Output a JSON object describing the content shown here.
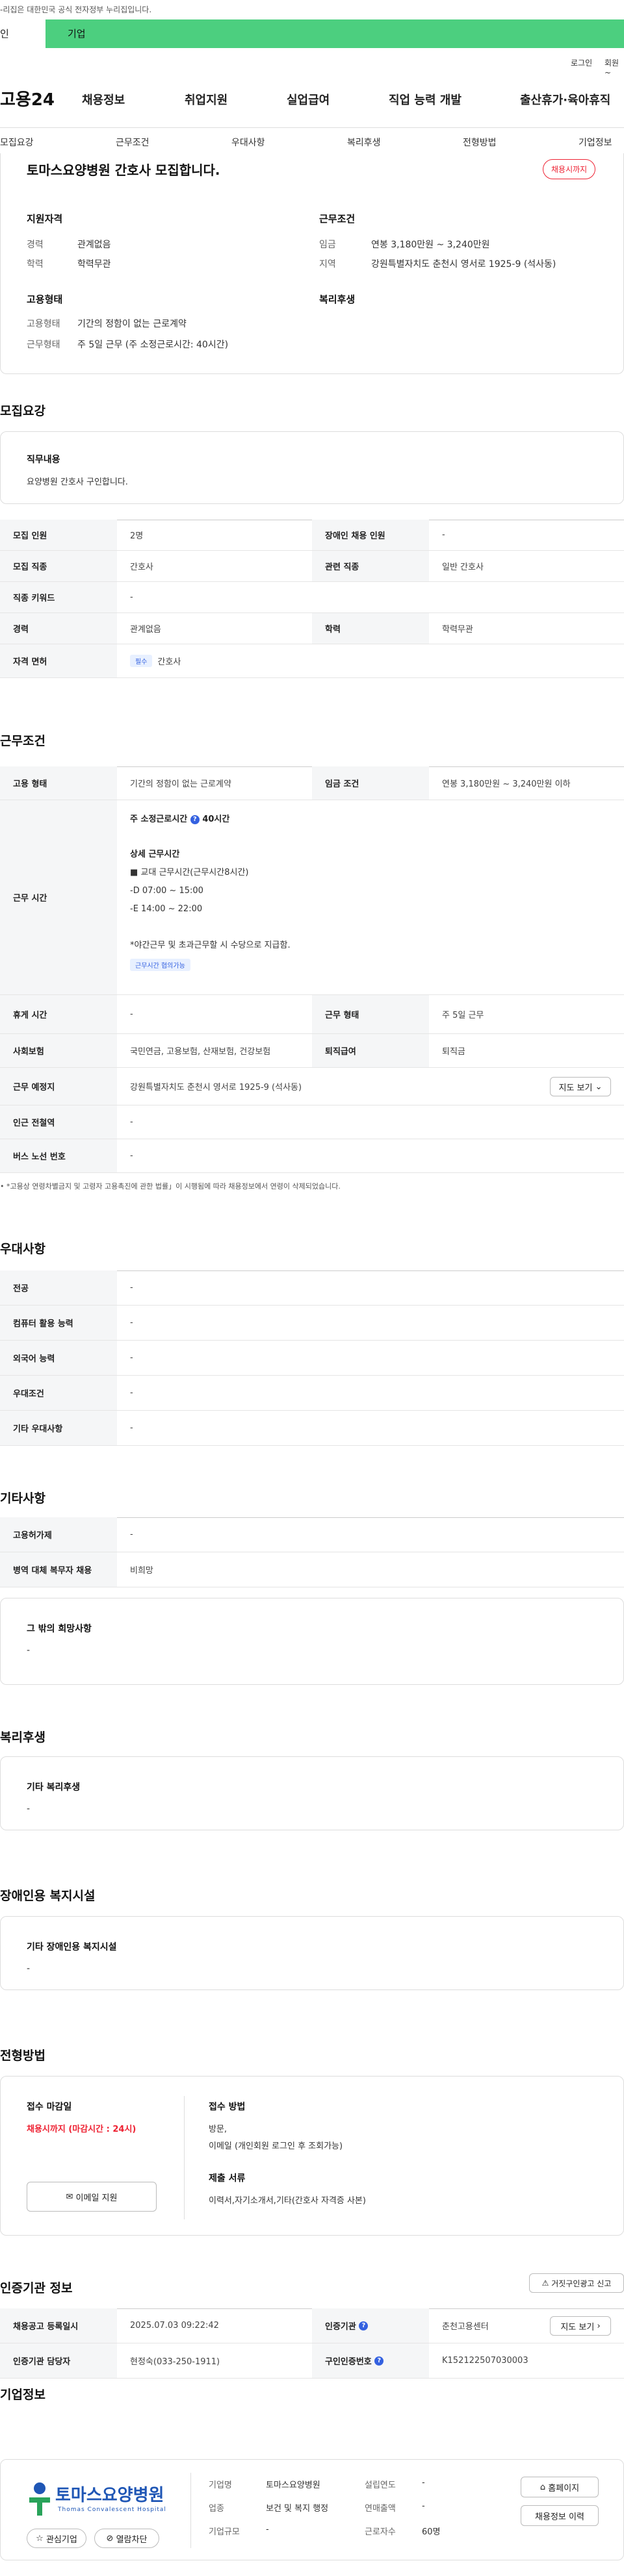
{
  "topbar": {
    "notice": "-리집은 대한민국 공식 전자정부 누리집입니다."
  },
  "user_tabs": [
    "인",
    "기업"
  ],
  "util_links": [
    "로그인",
    "회원~"
  ],
  "logo": "고용24",
  "gnb": [
    "채용정보",
    "취업지원",
    "실업급여",
    "직업 능력 개발",
    "출산휴가·육아휴직"
  ],
  "snb": [
    "모집요강",
    "근무조건",
    "우대사항",
    "복리후생",
    "전형방법",
    "기업정보"
  ],
  "summary": {
    "title": "토마스요양병원 간호사 모집합니다.",
    "badge": "채용시까지",
    "qual_title": "지원자격",
    "qual": [
      {
        "k": "경력",
        "v": "관계없음"
      },
      {
        "k": "학력",
        "v": "학력무관"
      }
    ],
    "cond_title": "근무조건",
    "cond": [
      {
        "k": "임금",
        "v": "연봉 3,180만원 ~ 3,240만원"
      },
      {
        "k": "지역",
        "v": "강원특별자치도 춘천시 영서로 1925-9 (석사동)"
      }
    ],
    "emp_title": "고용형태",
    "emp": [
      {
        "k": "고용형태",
        "v": "기간의 정함이 없는 근로계약"
      },
      {
        "k": "근무형태",
        "v": "주 5일 근무 (주 소정근로시간: 40시간)"
      }
    ],
    "welfare_title": "복리후생"
  },
  "recruit": {
    "heading": "모집요강",
    "duty_title": "직무내용",
    "duty": "요양병원 간호사 구인합니다.",
    "rows": [
      {
        "k1": "모집 인원",
        "v1": "2명",
        "k2": "장애인 채용 인원",
        "v2": "-"
      },
      {
        "k1": "모집 직종",
        "v1": "간호사",
        "k2": "관련 직종",
        "v2": "일반 간호사"
      },
      {
        "k1": "직종 키워드",
        "v1": "-"
      },
      {
        "k1": "경력",
        "v1": "관계없음",
        "k2": "학력",
        "v2": "학력무관"
      },
      {
        "k1": "자격 면허",
        "pill": "필수",
        "v1": "간호사"
      }
    ]
  },
  "work": {
    "heading": "근무조건",
    "type_k": "고용 형태",
    "type_v": "기간의 정함이 없는 근로계약",
    "wage_k": "임금 조건",
    "wage_v": "연봉 3,180만원 ~ 3,240만원 이하",
    "time_k": "근무 시간",
    "time_lines": [
      "주 소정근로시간",
      "40시간"
    ],
    "detail_title": "상세 근무시간",
    "detail": [
      "■ 교대 근무시간(근무시간8시간)",
      "-D 07:00 ~ 15:00",
      "-E 14:00 ~ 22:00",
      "",
      "*야간근무 및 초과근무할 시 수당으로 지급함."
    ],
    "detail_pill": "근무시간 협의가능",
    "rest_k": "휴게 시간",
    "rest_v": "-",
    "form_k": "근무 형태",
    "form_v": "주 5일 근무",
    "ins_k": "사회보험",
    "ins_v": "국민연금, 고용보험, 산재보험, 건강보험",
    "sev_k": "퇴직급여",
    "sev_v": "퇴직금",
    "place_k": "근무 예정지",
    "place_v": "강원특별자치도 춘천시 영서로 1925-9 (석사동)",
    "map_btn": "지도 보기",
    "station_k": "인근 전철역",
    "station_v": "-",
    "bus_k": "버스 노선 번호",
    "bus_v": "-",
    "note": "• *고용상 연령차별금지 및 고령자 고용촉진에 관한 법률」이 시행됨에 따라 채용정보에서 연령이 삭제되었습니다."
  },
  "pref": {
    "heading": "우대사항",
    "rows": [
      {
        "k": "전공",
        "v": "-"
      },
      {
        "k": "컴퓨터 활용 능력",
        "v": "-"
      },
      {
        "k": "외국어 능력",
        "v": "-"
      },
      {
        "k": "우대조건",
        "v": "-"
      },
      {
        "k": "기타 우대사항",
        "v": "-"
      }
    ]
  },
  "other": {
    "heading": "기타사항",
    "rows": [
      {
        "k": "고용허가제",
        "v": "-"
      },
      {
        "k": "병역 대체 복무자 채용",
        "v": "비희망"
      }
    ],
    "card_title": "그 밖의 희망사항",
    "card_v": "-"
  },
  "welfare": {
    "heading": "복리후생",
    "card_title": "기타 복리후생",
    "card_v": "-"
  },
  "disabled": {
    "heading": "장애인용 복지시설",
    "card_title": "기타 장애인용 복지시설",
    "card_v": "-"
  },
  "process": {
    "heading": "전형방법",
    "deadline_title": "접수 마감일",
    "deadline": "채용시까지 (마감시간 : 24시)",
    "email_btn": "이메일 지원",
    "method_title": "접수 방법",
    "method": [
      "방문,",
      "이메일 (개인회원 로그인 후 조회가능)"
    ],
    "docs_title": "제출 서류",
    "docs": "이력서,자기소개서,기타(간호사 자격증 사본)"
  },
  "cert": {
    "heading": "인증기관 정보",
    "report_btn": "거짓구인광고 신고",
    "r1": {
      "k1": "채용공고 등록일시",
      "v1": "2025.07.03 09:22:42",
      "k2": "인증기관",
      "v2": "춘천고용센터",
      "btn": "지도 보기"
    },
    "r2": {
      "k1": "인증기관 담당자",
      "v1": "현정숙(033-250-1911)",
      "k2": "구인인증번호",
      "v2": "K152122507030003"
    }
  },
  "company": {
    "heading": "기업정보",
    "logo_text": "토마스요양병원",
    "logo_sub": "Thomas Convalescent Hospital",
    "fav_btn": "관심기업",
    "block_btn": "열람차단",
    "fields": [
      {
        "k": "기업명",
        "v": "토마스요양병원",
        "k2": "설립연도",
        "v2": "-"
      },
      {
        "k": "업종",
        "v": "보건 및 복지 행정",
        "k2": "연매출액",
        "v2": "-"
      },
      {
        "k": "기업규모",
        "v": "-",
        "k2": "근로자수",
        "v2": "60명"
      }
    ],
    "home_btn": "홈페이지",
    "history_btn": "채용정보 이력"
  }
}
